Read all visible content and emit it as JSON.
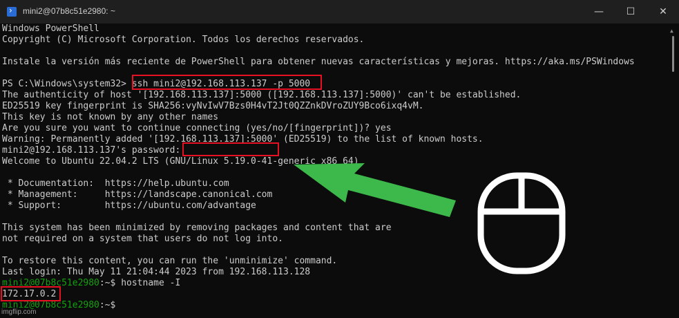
{
  "window": {
    "title": "mini2@07b8c51e2980: ~",
    "icon": "powershell-icon",
    "controls": {
      "minimize": "—",
      "maximize": "☐",
      "close": "✕"
    }
  },
  "terminal": {
    "lines": [
      "Windows PowerShell",
      "Copyright (C) Microsoft Corporation. Todos los derechos reservados.",
      "",
      "Instale la versión más reciente de PowerShell para obtener nuevas características y mejoras. https://aka.ms/PSWindows",
      "",
      "PS C:\\Windows\\system32> ssh mini2@192.168.113.137 -p 5000",
      "The authenticity of host '[192.168.113.137]:5000 ([192.168.113.137]:5000)' can't be established.",
      "ED25519 key fingerprint is SHA256:vyNvIwV7Bzs0H4vT2Jt0QZZnkDVroZUY9Bco6ixq4vM.",
      "This key is not known by any other names",
      "Are you sure you want to continue connecting (yes/no/[fingerprint])? yes",
      "Warning: Permanently added '[192.168.113.137]:5000' (ED25519) to the list of known hosts.",
      "mini2@192.168.113.137's password:",
      "Welcome to Ubuntu 22.04.2 LTS (GNU/Linux 5.19.0-41-generic x86_64)",
      "",
      " * Documentation:  https://help.ubuntu.com",
      " * Management:     https://landscape.canonical.com",
      " * Support:        https://ubuntu.com/advantage",
      "",
      "This system has been minimized by removing packages and content that are",
      "not required on a system that users do not log into.",
      "",
      "To restore this content, you can run the 'unminimize' command.",
      "Last login: Thu May 11 21:04:44 2023 from 192.168.113.128"
    ],
    "prompt1": "mini2@07b8c51e2980",
    "prompt1_suffix": ":~$ hostname -I",
    "output_ip": "172.17.0.2",
    "prompt2": "mini2@07b8c51e2980",
    "prompt2_suffix": ":~$"
  },
  "annotations": {
    "arrow_color": "#3cb94a",
    "highlight_color": "#e81123",
    "mouse_icon": "mouse-icon"
  },
  "watermark": "imgflip.com"
}
